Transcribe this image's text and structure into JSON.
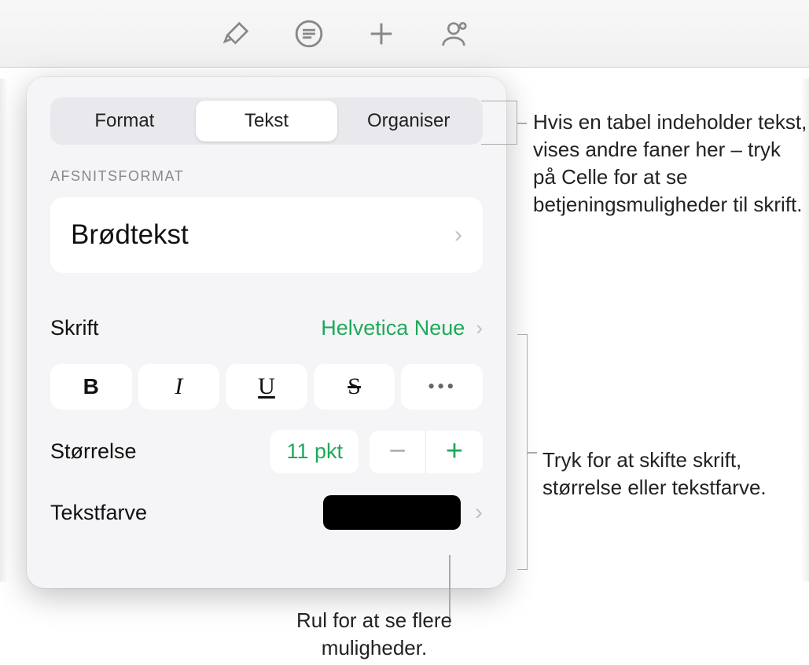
{
  "toolbar": {
    "icons": [
      "paintbrush-icon",
      "text-lines-icon",
      "plus-icon",
      "collaborate-icon"
    ]
  },
  "tabs": {
    "format": "Format",
    "text": "Tekst",
    "organize": "Organiser",
    "active": "text"
  },
  "sections": {
    "paragraph_format_label": "AFSNITSFORMAT",
    "paragraph_style": "Brødtekst",
    "font_label": "Skrift",
    "font_value": "Helvetica Neue",
    "style_buttons": {
      "bold": "B",
      "italic": "I",
      "underline": "U",
      "strike": "S",
      "more": "•••"
    },
    "size_label": "Størrelse",
    "size_value": "11 pkt",
    "minus": "−",
    "plus": "+",
    "textcolor_label": "Tekstfarve",
    "textcolor_value": "#000000"
  },
  "annotations": {
    "tabs_note": "Hvis en tabel indeholder tekst, vises andre faner her – tryk på Celle for at se betjeningsmuligheder til skrift.",
    "font_note": "Tryk for at skifte skrift, størrelse eller tekstfarve.",
    "scroll_note": "Rul for at se flere muligheder."
  }
}
